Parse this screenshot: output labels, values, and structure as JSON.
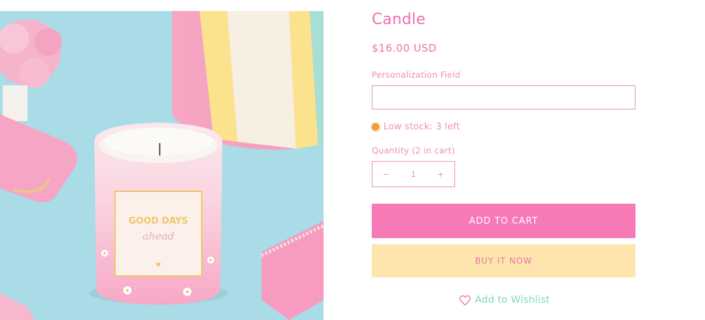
{
  "product": {
    "title": "Candle",
    "price": "$16.00 USD",
    "image_label": {
      "line1": "GOOD DAYS",
      "line2": "ahead"
    }
  },
  "personalization": {
    "label": "Personalization Field",
    "value": "",
    "placeholder": ""
  },
  "stock": {
    "text": "Low stock: 3 left",
    "status_color": "#f39a3d"
  },
  "quantity": {
    "label": "Quantity (2 in cart)",
    "decrease_symbol": "−",
    "value": "1",
    "increase_symbol": "+"
  },
  "actions": {
    "add_to_cart": "ADD TO CART",
    "buy_now": "BUY IT NOW",
    "wishlist": "Add to Wishlist"
  },
  "colors": {
    "accent_pink": "#ee6fae",
    "cart_button": "#f779b6",
    "buy_button": "#fde5ad",
    "wishlist_teal": "#7fd7c1"
  },
  "icons": {
    "wishlist": "heart-icon",
    "stock": "status-dot-icon"
  }
}
